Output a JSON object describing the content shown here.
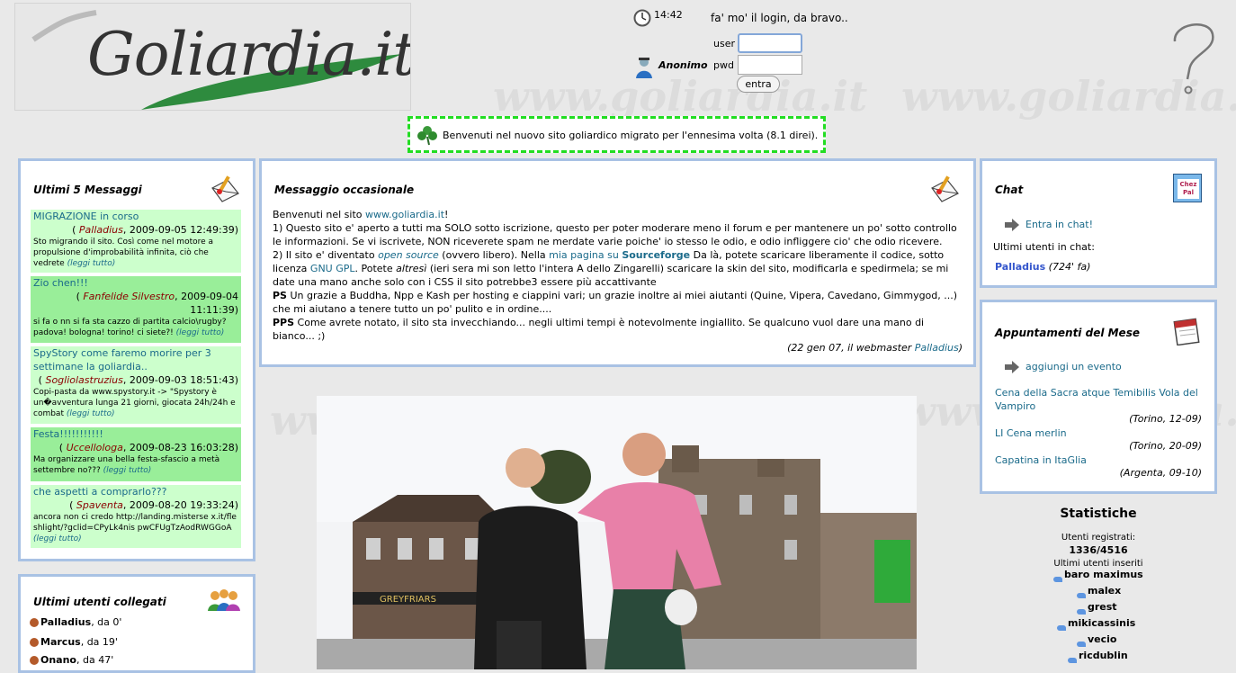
{
  "header": {
    "logo_text": "Goliardia.it",
    "watermark_text": "www.goliardia.it",
    "clock_time": "14:42",
    "login_message": "fa' mo' il login, da bravo..",
    "user_label": "user",
    "pwd_label": "pwd",
    "anon_name": "Anonimo",
    "submit_label": "entra"
  },
  "banner": {
    "text": "Benvenuti nel nuovo sito goliardico migrato per l'ennesima volta (8.1 direi)."
  },
  "messages_panel": {
    "title": "Ultimi 5 Messaggi",
    "items": [
      {
        "title": "MIGRAZIONE in corso",
        "author": "Palladius",
        "date": ", 2009-09-05 12:49:39)",
        "open": "(",
        "body": "Sto migrando il sito. Così come nel motore a propulsione d'improbabilità infinita, ciò che vedrete",
        "more": "(leggi tutto)"
      },
      {
        "title": "Zio chen!!!",
        "author": "Fanfelide Silvestro",
        "date": ", 2009-09-04 11:11:39)",
        "open": "(",
        "body": "si fa o nn si fa sta cazzo di partita calcio\\rugby? padova! bologna! torino! ci siete?!",
        "more": "(leggi tutto)"
      },
      {
        "title": "SpyStory come faremo morire per 3 settimane la goliardia..",
        "author": "Sogliolastruzius",
        "date": ", 2009-09-03 18:51:43)",
        "open": "(",
        "body": "Copi-pasta da www.spystory.it -> \"Spystory è un�avventura lunga 21 giorni, giocata 24h/24h e combat",
        "more": "(leggi tutto)"
      },
      {
        "title": "Festa!!!!!!!!!!!",
        "author": "Uccellologa",
        "date": ", 2009-08-23 16:03:28)",
        "open": "(",
        "body": "Ma organizzare una bella festa-sfascio a metà settembre no???",
        "more": "(leggi tutto)"
      },
      {
        "title": "che aspetti a comprarlo???",
        "author": "Spaventa",
        "date": ", 2009-08-20 19:33:24)",
        "open": "(",
        "body": "ancora non ci credo http://landing.misterse x.it/fleshlight/?gclid=CPyLk4nis pwCFUgTzAodRWGGoA",
        "more": "(leggi tutto)"
      }
    ]
  },
  "users_panel": {
    "title": "Ultimi utenti collegati",
    "users": [
      {
        "name": "Palladius",
        "since": ", da 0'"
      },
      {
        "name": "Marcus",
        "since": ", da 19'"
      },
      {
        "name": "Onano",
        "since": ", da 47'"
      }
    ]
  },
  "occasional": {
    "title": "Messaggio occasionale",
    "p1_a": "Benvenuti nel sito ",
    "p1_link": "www.goliardia.it",
    "p1_b": "!",
    "p2": "1) Questo sito e' aperto a tutti ma SOLO sotto iscrizione, questo per poter moderare meno il forum e per mantenere un po' sotto controllo le informazioni. Se vi iscrivete, NON riceverete spam ne merdate varie poiche' io stesso le odio, e odio infliggere cio' che odio ricevere.",
    "p3_a": "2) Il sito e' diventato ",
    "p3_os": "open source",
    "p3_b": " (ovvero libero). Nella ",
    "p3_link1": "mia pagina su ",
    "p3_link2": "Sourceforge",
    "p3_c": " Da là, potete scaricare liberamente il codice, sotto licenza ",
    "p3_gpl": "GNU GPL",
    "p3_d": ". Potete ",
    "p3_altresi": "altresì",
    "p3_e": " (ieri sera mi son letto l'intera A dello Zingarelli) scaricare la skin del sito, modificarla e spedirmela; se mi date una mano anche solo con i CSS il sito potrebbe3 essere più accattivante",
    "ps_label": "PS",
    "ps_text": " Un grazie a Buddha, Npp e Kash per hosting e ciappini vari; un grazie inoltre ai miei aiutanti (Quine, Vipera, Cavedano, Gimmygod, ...) che mi aiutano a tenere tutto un po' pulito e in ordine....",
    "pps_label": "PPS",
    "pps_text": " Come avrete notato, il sito sta invecchiando... negli ultimi tempi è notevolmente ingiallito. Se qualcuno vuol dare una mano di bianco... ;)",
    "sign_a": "(22 gen 07, il webmaster ",
    "sign_link": "Palladius",
    "sign_b": ")"
  },
  "chat": {
    "title": "Chat",
    "icon_text": "Chez Pal",
    "enter_label": "Entra in chat!",
    "last_users_label": "Ultimi utenti in chat:",
    "user": "Palladius",
    "user_ago": " (724' fa)"
  },
  "events": {
    "title": "Appuntamenti del Mese",
    "add_label": "aggiungi un evento",
    "items": [
      {
        "title": "Cena della Sacra atque Temibilis Vola del Vampiro",
        "meta": "(Torino, 12-09)"
      },
      {
        "title": "LI Cena merlin",
        "meta": "(Torino, 20-09)"
      },
      {
        "title": "Capatina in ItaGlia",
        "meta": "(Argenta, 09-10)"
      }
    ]
  },
  "stats": {
    "title": "Statistiche",
    "registered_label": "Utenti registrati:",
    "registered_value": "1336/4516",
    "last_inserted_label": "Ultimi utenti inseriti",
    "users": [
      "baro maximus",
      "malex",
      "grest",
      "mikicassinis",
      "vecio",
      "ricdublin"
    ]
  },
  "photo": {
    "pub_sign": "GREYFRIARS"
  },
  "colors": {
    "panel_border": "#a9c2e4",
    "message_bg": "#ccffcc",
    "message_bg_alt": "#99ee99",
    "link": "#1a6a8a",
    "author": "#8b0000",
    "banner_border": "#22dd22",
    "chat_user": "#3355cc"
  }
}
